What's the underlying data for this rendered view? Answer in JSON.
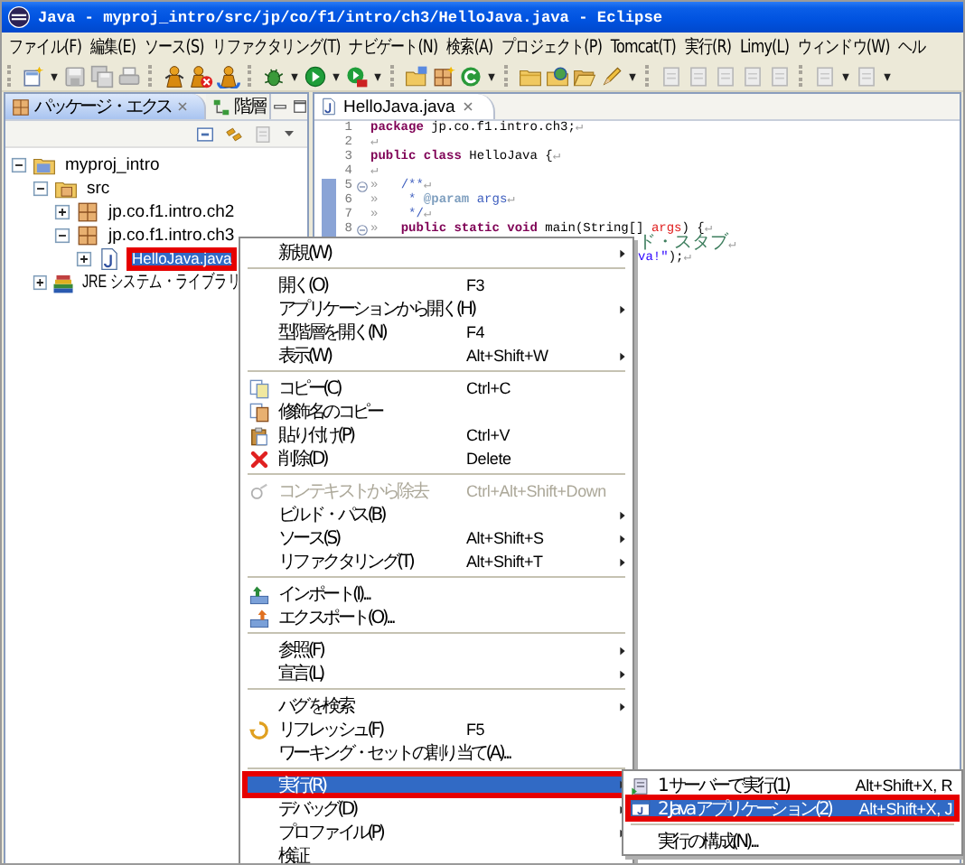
{
  "window": {
    "title": "Java - myproj_intro/src/jp/co/f1/intro/ch3/HelloJava.java - Eclipse"
  },
  "menu_bar": [
    "ファイル(F)",
    "編集(E)",
    "ソース(S)",
    "リファクタリング(T)",
    "ナビゲート(N)",
    "検索(A)",
    "プロジェクト(P)",
    "Tomcat(T)",
    "実行(R)",
    "Limy(L)",
    "ウィンドウ(W)",
    "ヘル"
  ],
  "explorer": {
    "tabs": [
      {
        "label": "パッケージ・エクス",
        "selected": true
      },
      {
        "label": "階層",
        "selected": false
      }
    ],
    "tree": [
      {
        "label": "myproj_intro",
        "kind": "project",
        "expanded": true,
        "selected": false,
        "highlighted": false,
        "children": [
          {
            "label": "src",
            "kind": "source-folder",
            "expanded": true,
            "selected": false,
            "highlighted": false,
            "children": [
              {
                "label": "jp.co.f1.intro.ch2",
                "kind": "package",
                "expanded": false,
                "selected": false,
                "highlighted": false
              },
              {
                "label": "jp.co.f1.intro.ch3",
                "kind": "package",
                "expanded": true,
                "selected": false,
                "highlighted": false,
                "children": [
                  {
                    "label": "HelloJava.java",
                    "kind": "java-file",
                    "expanded": false,
                    "selected": true,
                    "highlighted": true
                  }
                ]
              }
            ]
          },
          {
            "label": "JRE システム・ライブラリ",
            "kind": "library",
            "expanded": false,
            "selected": false,
            "highlighted": false
          }
        ]
      }
    ]
  },
  "editor": {
    "tab": "HelloJava.java",
    "lines": [
      {
        "kind": "full",
        "number": "1",
        "fold": false,
        "range": false,
        "tokens": [
          {
            "kind": "keyword",
            "text": "package"
          },
          {
            "kind": "plain",
            "text": " jp.co.f1.intro.ch3;"
          },
          {
            "kind": "whitespace",
            "text": "↵"
          }
        ]
      },
      {
        "kind": "full",
        "number": "2",
        "fold": false,
        "range": false,
        "tokens": [
          {
            "kind": "whitespace",
            "text": "↵"
          }
        ]
      },
      {
        "kind": "full",
        "number": "3",
        "fold": false,
        "range": false,
        "tokens": [
          {
            "kind": "keyword",
            "text": "public class"
          },
          {
            "kind": "plain",
            "text": " HelloJava {"
          },
          {
            "kind": "whitespace",
            "text": "↵"
          }
        ]
      },
      {
        "kind": "full",
        "number": "4",
        "fold": false,
        "range": false,
        "tokens": [
          {
            "kind": "whitespace",
            "text": "↵"
          }
        ]
      },
      {
        "kind": "full",
        "number": "5",
        "fold": true,
        "range": true,
        "tokens": [
          {
            "kind": "whitespace",
            "text": "»   "
          },
          {
            "kind": "javadoc",
            "text": "/**"
          },
          {
            "kind": "whitespace",
            "text": "↵"
          }
        ]
      },
      {
        "kind": "full",
        "number": "6",
        "fold": false,
        "range": true,
        "tokens": [
          {
            "kind": "whitespace",
            "text": "»   "
          },
          {
            "kind": "javadoc",
            "text": " * "
          },
          {
            "kind": "tag",
            "text": "@param"
          },
          {
            "kind": "javadoc",
            "text": " args"
          },
          {
            "kind": "whitespace",
            "text": "↵"
          }
        ]
      },
      {
        "kind": "full",
        "number": "7",
        "fold": false,
        "range": true,
        "tokens": [
          {
            "kind": "whitespace",
            "text": "»   "
          },
          {
            "kind": "javadoc",
            "text": " */"
          },
          {
            "kind": "whitespace",
            "text": "↵"
          }
        ]
      },
      {
        "kind": "full",
        "number": "8",
        "fold": true,
        "range": true,
        "tokens": [
          {
            "kind": "whitespace",
            "text": "»   "
          },
          {
            "kind": "keyword",
            "text": "public static void"
          },
          {
            "kind": "plain",
            "text": " main(String[] "
          },
          {
            "kind": "param",
            "text": "args"
          },
          {
            "kind": "plain",
            "text": ") {"
          },
          {
            "kind": "whitespace",
            "text": "↵"
          }
        ]
      },
      {
        "kind": "partial",
        "tokens": [
          {
            "kind": "comment",
            "text": "ド・スタブ"
          },
          {
            "kind": "whitespace",
            "text": "↵"
          }
        ]
      },
      {
        "kind": "partial",
        "tokens": [
          {
            "kind": "string",
            "text": "va!\""
          },
          {
            "kind": "plain",
            "text": ");"
          },
          {
            "kind": "whitespace",
            "text": "↵"
          }
        ]
      }
    ]
  },
  "context_menu": {
    "items": [
      {
        "kind": "plain",
        "label": "新規(W)",
        "submenu": true,
        "disabled": false,
        "selected": false,
        "highlighted": false
      },
      {
        "kind": "separator"
      },
      {
        "kind": "plain",
        "label": "開く(O)",
        "shortcut": "F3",
        "submenu": false,
        "disabled": false,
        "selected": false,
        "highlighted": false
      },
      {
        "kind": "plain",
        "label": "アプリケーションから開く(H)",
        "submenu": true,
        "disabled": false,
        "selected": false,
        "highlighted": false
      },
      {
        "kind": "plain",
        "label": "型階層を開く(N)",
        "shortcut": "F4",
        "submenu": false,
        "disabled": false,
        "selected": false,
        "highlighted": false
      },
      {
        "kind": "plain",
        "label": "表示(W)",
        "shortcut": "Alt+Shift+W",
        "submenu": true,
        "disabled": false,
        "selected": false,
        "highlighted": false
      },
      {
        "kind": "separator"
      },
      {
        "kind": "copy",
        "label": "コピー(C)",
        "shortcut": "Ctrl+C",
        "submenu": false,
        "disabled": false,
        "selected": false,
        "highlighted": false
      },
      {
        "kind": "copy-qualified",
        "label": "修飾名のコピー",
        "submenu": false,
        "disabled": false,
        "selected": false,
        "highlighted": false
      },
      {
        "kind": "paste",
        "label": "貼り付け(P)",
        "shortcut": "Ctrl+V",
        "submenu": false,
        "disabled": false,
        "selected": false,
        "highlighted": false
      },
      {
        "kind": "delete",
        "label": "削除(D)",
        "shortcut": "Delete",
        "submenu": false,
        "disabled": false,
        "selected": false,
        "highlighted": false
      },
      {
        "kind": "separator"
      },
      {
        "kind": "remove-context",
        "label": "コンテキストから除去",
        "shortcut": "Ctrl+Alt+Shift+Down",
        "submenu": false,
        "disabled": true,
        "selected": false,
        "highlighted": false
      },
      {
        "kind": "plain",
        "label": "ビルド・パス(B)",
        "submenu": true,
        "disabled": false,
        "selected": false,
        "highlighted": false
      },
      {
        "kind": "plain",
        "label": "ソース(S)",
        "shortcut": "Alt+Shift+S",
        "submenu": true,
        "disabled": false,
        "selected": false,
        "highlighted": false
      },
      {
        "kind": "plain",
        "label": "リファクタリング(T)",
        "shortcut": "Alt+Shift+T",
        "submenu": true,
        "disabled": false,
        "selected": false,
        "highlighted": false
      },
      {
        "kind": "separator"
      },
      {
        "kind": "import",
        "label": "インポート(I)...",
        "submenu": false,
        "disabled": false,
        "selected": false,
        "highlighted": false
      },
      {
        "kind": "export",
        "label": "エクスポート(O)...",
        "submenu": false,
        "disabled": false,
        "selected": false,
        "highlighted": false
      },
      {
        "kind": "separator"
      },
      {
        "kind": "plain",
        "label": "参照(F)",
        "submenu": true,
        "disabled": false,
        "selected": false,
        "highlighted": false
      },
      {
        "kind": "plain",
        "label": "宣言(L)",
        "submenu": true,
        "disabled": false,
        "selected": false,
        "highlighted": false
      },
      {
        "kind": "separator"
      },
      {
        "kind": "plain",
        "label": "バグを検索",
        "submenu": true,
        "disabled": false,
        "selected": false,
        "highlighted": false
      },
      {
        "kind": "refresh",
        "label": "リフレッシュ(F)",
        "shortcut": "F5",
        "submenu": false,
        "disabled": false,
        "selected": false,
        "highlighted": false
      },
      {
        "kind": "plain",
        "label": "ワーキング・セットの割り当て(A)...",
        "submenu": false,
        "disabled": false,
        "selected": false,
        "highlighted": false
      },
      {
        "kind": "separator"
      },
      {
        "kind": "plain",
        "label": "実行(R)",
        "submenu": true,
        "disabled": false,
        "selected": true,
        "highlighted": true
      },
      {
        "kind": "plain",
        "label": "デバッグ(D)",
        "submenu": true,
        "disabled": false,
        "selected": false,
        "highlighted": false
      },
      {
        "kind": "plain",
        "label": "プロファイル(P)",
        "submenu": true,
        "disabled": false,
        "selected": false,
        "highlighted": false
      },
      {
        "kind": "plain",
        "label": "検証",
        "submenu": false,
        "disabled": false,
        "selected": false,
        "highlighted": false
      }
    ]
  },
  "run_submenu": {
    "items": [
      {
        "kind": "server",
        "label": "1 サーバーで実行(1)",
        "shortcut": "Alt+Shift+X, R",
        "submenu": false,
        "disabled": false,
        "selected": false,
        "highlighted": false
      },
      {
        "kind": "java-app",
        "label": "2 Java アプリケーション(2)",
        "shortcut": "Alt+Shift+X, J",
        "submenu": false,
        "disabled": false,
        "selected": true,
        "highlighted": true
      },
      {
        "kind": "separator"
      },
      {
        "kind": "plain",
        "label": "実行の構成(N)...",
        "submenu": false,
        "disabled": false,
        "selected": false,
        "highlighted": false
      }
    ]
  }
}
